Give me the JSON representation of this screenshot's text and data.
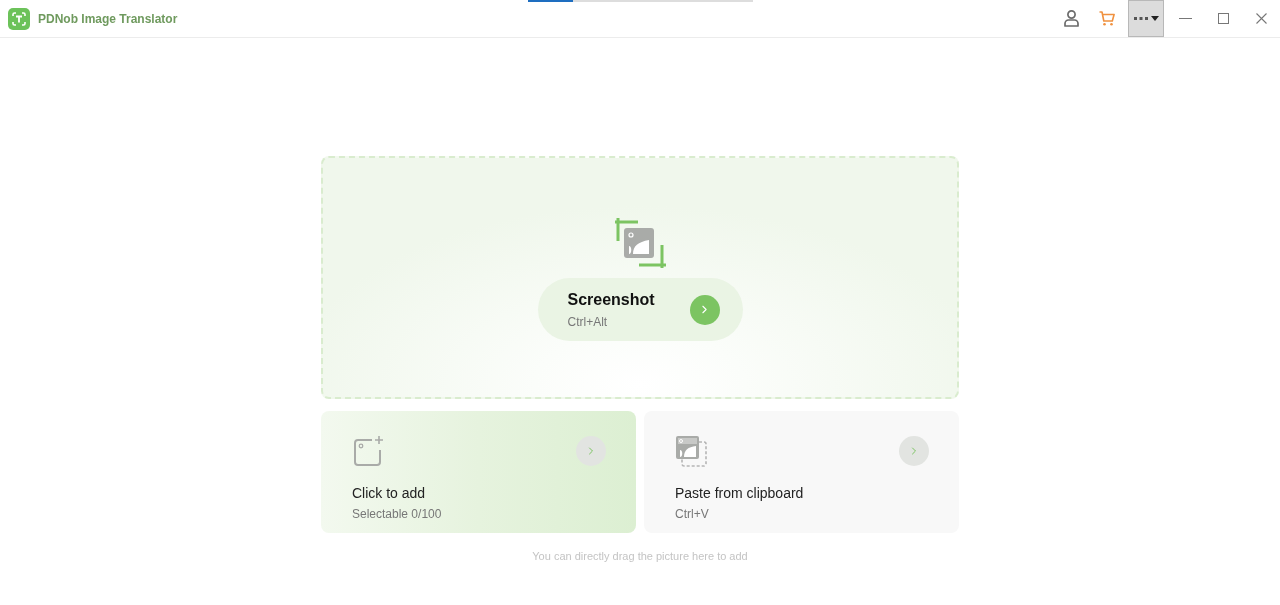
{
  "app": {
    "title": "PDNob Image Translator"
  },
  "progress": {
    "level": 0.2
  },
  "screenshot": {
    "label": "Screenshot",
    "shortcut": "Ctrl+Alt"
  },
  "cards": [
    {
      "kind": "add",
      "title": "Click to add",
      "subtitle": "Selectable 0/100",
      "selected": true
    },
    {
      "kind": "paste",
      "title": "Paste from clipboard",
      "subtitle": "Ctrl+V",
      "selected": false
    }
  ],
  "hint": "You can directly drag the picture here to add"
}
